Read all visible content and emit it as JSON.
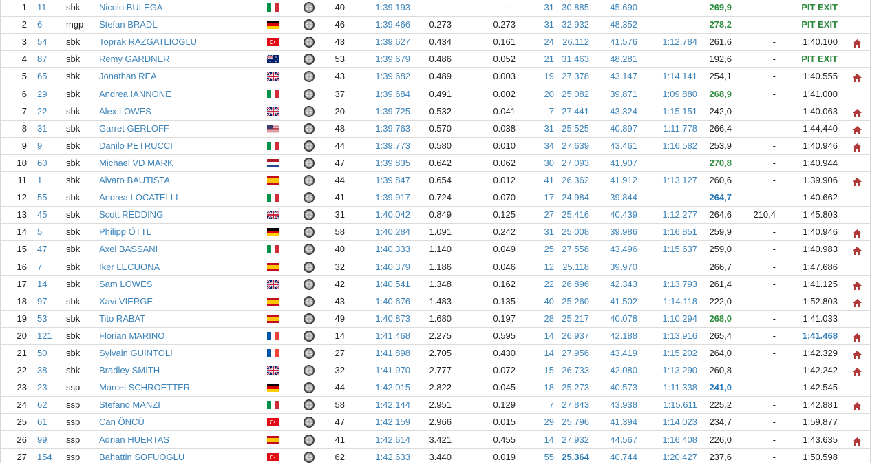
{
  "colors": {
    "link": "#3b83b9",
    "best_green": "#2e8b3e",
    "best_blue": "#2a7ab8",
    "home_icon": "#b03a3a"
  },
  "rows": [
    {
      "pos": "1",
      "num": "11",
      "cls": "sbk",
      "name": "Nicolo BULEGA",
      "flag": "ita",
      "laps": "40",
      "best": "1:39.193",
      "gap": "--",
      "prev": "-----",
      "best_lap": "31",
      "s1": "30.885",
      "s2": "45.690",
      "s3": "",
      "speed": "269,9",
      "speed_style": "green",
      "speed2": "-",
      "last": "PIT EXIT",
      "last_style": "pit",
      "home": false
    },
    {
      "pos": "2",
      "num": "6",
      "cls": "mgp",
      "name": "Stefan BRADL",
      "flag": "ger",
      "laps": "46",
      "best": "1:39.466",
      "gap": "0.273",
      "prev": "0.273",
      "best_lap": "31",
      "s1": "32.932",
      "s2": "48.352",
      "s3": "",
      "speed": "278,2",
      "speed_style": "green",
      "speed2": "-",
      "last": "PIT EXIT",
      "last_style": "pit",
      "home": false
    },
    {
      "pos": "3",
      "num": "54",
      "cls": "sbk",
      "name": "Toprak RAZGATLIOGLU",
      "flag": "tur",
      "laps": "43",
      "best": "1:39.627",
      "gap": "0.434",
      "prev": "0.161",
      "best_lap": "24",
      "s1": "26.112",
      "s2": "41.576",
      "s3": "1:12.784",
      "speed": "261,6",
      "speed_style": "",
      "speed2": "-",
      "last": "1:40.100",
      "last_style": "",
      "home": true
    },
    {
      "pos": "4",
      "num": "87",
      "cls": "sbk",
      "name": "Remy GARDNER",
      "flag": "aus",
      "laps": "53",
      "best": "1:39.679",
      "gap": "0.486",
      "prev": "0.052",
      "best_lap": "21",
      "s1": "31.463",
      "s2": "48.281",
      "s3": "",
      "speed": "192,6",
      "speed_style": "",
      "speed2": "-",
      "last": "PIT EXIT",
      "last_style": "pit",
      "home": false
    },
    {
      "pos": "5",
      "num": "65",
      "cls": "sbk",
      "name": "Jonathan REA",
      "flag": "gbr",
      "laps": "43",
      "best": "1:39.682",
      "gap": "0.489",
      "prev": "0.003",
      "best_lap": "19",
      "s1": "27.378",
      "s2": "43.147",
      "s3": "1:14.141",
      "speed": "254,1",
      "speed_style": "",
      "speed2": "-",
      "last": "1:40.555",
      "last_style": "",
      "home": true
    },
    {
      "pos": "6",
      "num": "29",
      "cls": "sbk",
      "name": "Andrea IANNONE",
      "flag": "ita",
      "laps": "37",
      "best": "1:39.684",
      "gap": "0.491",
      "prev": "0.002",
      "best_lap": "20",
      "s1": "25.082",
      "s2": "39.871",
      "s3": "1:09.880",
      "speed": "268,9",
      "speed_style": "green",
      "speed2": "-",
      "last": "1:41.000",
      "last_style": "",
      "home": false
    },
    {
      "pos": "7",
      "num": "22",
      "cls": "sbk",
      "name": "Alex LOWES",
      "flag": "gbr",
      "laps": "20",
      "best": "1:39.725",
      "gap": "0.532",
      "prev": "0.041",
      "best_lap": "7",
      "s1": "27.441",
      "s2": "43.324",
      "s3": "1:15.151",
      "speed": "242,0",
      "speed_style": "",
      "speed2": "-",
      "last": "1:40.063",
      "last_style": "",
      "home": true
    },
    {
      "pos": "8",
      "num": "31",
      "cls": "sbk",
      "name": "Garret GERLOFF",
      "flag": "usa",
      "laps": "48",
      "best": "1:39.763",
      "gap": "0.570",
      "prev": "0.038",
      "best_lap": "31",
      "s1": "25.525",
      "s2": "40.897",
      "s3": "1:11.778",
      "speed": "266,4",
      "speed_style": "",
      "speed2": "-",
      "last": "1:44.440",
      "last_style": "",
      "home": true
    },
    {
      "pos": "9",
      "num": "9",
      "cls": "sbk",
      "name": "Danilo PETRUCCI",
      "flag": "ita",
      "laps": "44",
      "best": "1:39.773",
      "gap": "0.580",
      "prev": "0.010",
      "best_lap": "34",
      "s1": "27.639",
      "s2": "43.461",
      "s3": "1:16.582",
      "speed": "253,9",
      "speed_style": "",
      "speed2": "-",
      "last": "1:40.946",
      "last_style": "",
      "home": true
    },
    {
      "pos": "10",
      "num": "60",
      "cls": "sbk",
      "name": "Michael VD MARK",
      "flag": "ned",
      "laps": "47",
      "best": "1:39.835",
      "gap": "0.642",
      "prev": "0.062",
      "best_lap": "30",
      "s1": "27.093",
      "s2": "41.907",
      "s3": "",
      "speed": "270,8",
      "speed_style": "green",
      "speed2": "-",
      "last": "1:40.944",
      "last_style": "",
      "home": false
    },
    {
      "pos": "11",
      "num": "1",
      "cls": "sbk",
      "name": "Alvaro BAUTISTA",
      "flag": "esp",
      "laps": "44",
      "best": "1:39.847",
      "gap": "0.654",
      "prev": "0.012",
      "best_lap": "41",
      "s1": "26.362",
      "s2": "41.912",
      "s3": "1:13.127",
      "speed": "260,6",
      "speed_style": "",
      "speed2": "-",
      "last": "1:39.906",
      "last_style": "",
      "home": true
    },
    {
      "pos": "12",
      "num": "55",
      "cls": "sbk",
      "name": "Andrea LOCATELLI",
      "flag": "ita",
      "laps": "41",
      "best": "1:39.917",
      "gap": "0.724",
      "prev": "0.070",
      "best_lap": "17",
      "s1": "24.984",
      "s2": "39.844",
      "s3": "",
      "speed": "264,7",
      "speed_style": "blue",
      "speed2": "-",
      "last": "1:40.662",
      "last_style": "",
      "home": false
    },
    {
      "pos": "13",
      "num": "45",
      "cls": "sbk",
      "name": "Scott REDDING",
      "flag": "gbr",
      "laps": "31",
      "best": "1:40.042",
      "gap": "0.849",
      "prev": "0.125",
      "best_lap": "27",
      "s1": "25.416",
      "s2": "40.439",
      "s3": "1:12.277",
      "speed": "264,6",
      "speed_style": "",
      "speed2": "210,4",
      "last": "1:45.803",
      "last_style": "",
      "home": false
    },
    {
      "pos": "14",
      "num": "5",
      "cls": "sbk",
      "name": "Philipp ÖTTL",
      "flag": "ger",
      "laps": "58",
      "best": "1:40.284",
      "gap": "1.091",
      "prev": "0.242",
      "best_lap": "31",
      "s1": "25.008",
      "s2": "39.986",
      "s3": "1:16.851",
      "speed": "259,9",
      "speed_style": "",
      "speed2": "-",
      "last": "1:40.946",
      "last_style": "",
      "home": true
    },
    {
      "pos": "15",
      "num": "47",
      "cls": "sbk",
      "name": "Axel BASSANI",
      "flag": "ita",
      "laps": "40",
      "best": "1:40.333",
      "gap": "1.140",
      "prev": "0.049",
      "best_lap": "25",
      "s1": "27.558",
      "s2": "43.496",
      "s3": "1:15.637",
      "speed": "259,0",
      "speed_style": "",
      "speed2": "-",
      "last": "1:40.983",
      "last_style": "",
      "home": true
    },
    {
      "pos": "16",
      "num": "7",
      "cls": "sbk",
      "name": "Iker LECUONA",
      "flag": "esp",
      "laps": "32",
      "best": "1:40.379",
      "gap": "1.186",
      "prev": "0.046",
      "best_lap": "12",
      "s1": "25.118",
      "s2": "39.970",
      "s3": "",
      "speed": "266,7",
      "speed_style": "",
      "speed2": "-",
      "last": "1:47.686",
      "last_style": "",
      "home": false
    },
    {
      "pos": "17",
      "num": "14",
      "cls": "sbk",
      "name": "Sam LOWES",
      "flag": "gbr",
      "laps": "42",
      "best": "1:40.541",
      "gap": "1.348",
      "prev": "0.162",
      "best_lap": "22",
      "s1": "26.896",
      "s2": "42.343",
      "s3": "1:13.793",
      "speed": "261,4",
      "speed_style": "",
      "speed2": "-",
      "last": "1:41.125",
      "last_style": "",
      "home": true
    },
    {
      "pos": "18",
      "num": "97",
      "cls": "sbk",
      "name": "Xavi VIERGE",
      "flag": "esp",
      "laps": "43",
      "best": "1:40.676",
      "gap": "1.483",
      "prev": "0.135",
      "best_lap": "40",
      "s1": "25.260",
      "s2": "41.502",
      "s3": "1:14.118",
      "speed": "222,0",
      "speed_style": "",
      "speed2": "-",
      "last": "1:52.803",
      "last_style": "",
      "home": true
    },
    {
      "pos": "19",
      "num": "53",
      "cls": "sbk",
      "name": "Tito RABAT",
      "flag": "esp",
      "laps": "49",
      "best": "1:40.873",
      "gap": "1.680",
      "prev": "0.197",
      "best_lap": "28",
      "s1": "25.217",
      "s2": "40.078",
      "s3": "1:10.294",
      "speed": "268,0",
      "speed_style": "green",
      "speed2": "-",
      "last": "1:41.033",
      "last_style": "",
      "home": false
    },
    {
      "pos": "20",
      "num": "121",
      "cls": "sbk",
      "name": "Florian MARINO",
      "flag": "fra",
      "laps": "14",
      "best": "1:41.468",
      "gap": "2.275",
      "prev": "0.595",
      "best_lap": "14",
      "s1": "26.937",
      "s2": "42.188",
      "s3": "1:13.916",
      "speed": "265,4",
      "speed_style": "",
      "speed2": "-",
      "last": "1:41.468",
      "last_style": "blue",
      "home": true
    },
    {
      "pos": "21",
      "num": "50",
      "cls": "sbk",
      "name": "Sylvain GUINTOLI",
      "flag": "fra",
      "laps": "27",
      "best": "1:41.898",
      "gap": "2.705",
      "prev": "0.430",
      "best_lap": "14",
      "s1": "27.956",
      "s2": "43.419",
      "s3": "1:15.202",
      "speed": "264,0",
      "speed_style": "",
      "speed2": "-",
      "last": "1:42.329",
      "last_style": "",
      "home": true
    },
    {
      "pos": "22",
      "num": "38",
      "cls": "sbk",
      "name": "Bradley SMITH",
      "flag": "gbr",
      "laps": "32",
      "best": "1:41.970",
      "gap": "2.777",
      "prev": "0.072",
      "best_lap": "15",
      "s1": "26.733",
      "s2": "42.080",
      "s3": "1:13.290",
      "speed": "260,8",
      "speed_style": "",
      "speed2": "-",
      "last": "1:42.242",
      "last_style": "",
      "home": true
    },
    {
      "pos": "23",
      "num": "23",
      "cls": "ssp",
      "name": "Marcel SCHROETTER",
      "flag": "ger",
      "laps": "44",
      "best": "1:42.015",
      "gap": "2.822",
      "prev": "0.045",
      "best_lap": "18",
      "s1": "25.273",
      "s2": "40.573",
      "s3": "1:11.338",
      "speed": "241,0",
      "speed_style": "blue",
      "speed2": "-",
      "last": "1:42.545",
      "last_style": "",
      "home": false
    },
    {
      "pos": "24",
      "num": "62",
      "cls": "ssp",
      "name": "Stefano MANZI",
      "flag": "ita",
      "laps": "58",
      "best": "1:42.144",
      "gap": "2.951",
      "prev": "0.129",
      "best_lap": "7",
      "s1": "27.843",
      "s2": "43.938",
      "s3": "1:15.611",
      "speed": "225,2",
      "speed_style": "",
      "speed2": "-",
      "last": "1:42.881",
      "last_style": "",
      "home": true
    },
    {
      "pos": "25",
      "num": "61",
      "cls": "ssp",
      "name": "Can ÖNCÜ",
      "flag": "tur",
      "laps": "47",
      "best": "1:42.159",
      "gap": "2.966",
      "prev": "0.015",
      "best_lap": "29",
      "s1": "25.796",
      "s2": "41.394",
      "s3": "1:14.023",
      "speed": "234,7",
      "speed_style": "",
      "speed2": "-",
      "last": "1:59.877",
      "last_style": "",
      "home": false
    },
    {
      "pos": "26",
      "num": "99",
      "cls": "ssp",
      "name": "Adrian HUERTAS",
      "flag": "esp",
      "laps": "41",
      "best": "1:42.614",
      "gap": "3.421",
      "prev": "0.455",
      "best_lap": "14",
      "s1": "27.932",
      "s2": "44.567",
      "s3": "1:16.408",
      "speed": "226,0",
      "speed_style": "",
      "speed2": "-",
      "last": "1:43.635",
      "last_style": "",
      "home": true
    },
    {
      "pos": "27",
      "num": "154",
      "cls": "ssp",
      "name": "Bahattin SOFUOGLU",
      "flag": "tur",
      "laps": "62",
      "best": "1:42.633",
      "gap": "3.440",
      "prev": "0.019",
      "best_lap": "55",
      "s1": "25.364",
      "s1_style": "blue",
      "s2": "40.744",
      "s3": "1:20.427",
      "speed": "237,6",
      "speed_style": "",
      "speed2": "-",
      "last": "1:50.598",
      "last_style": "",
      "home": false
    }
  ]
}
